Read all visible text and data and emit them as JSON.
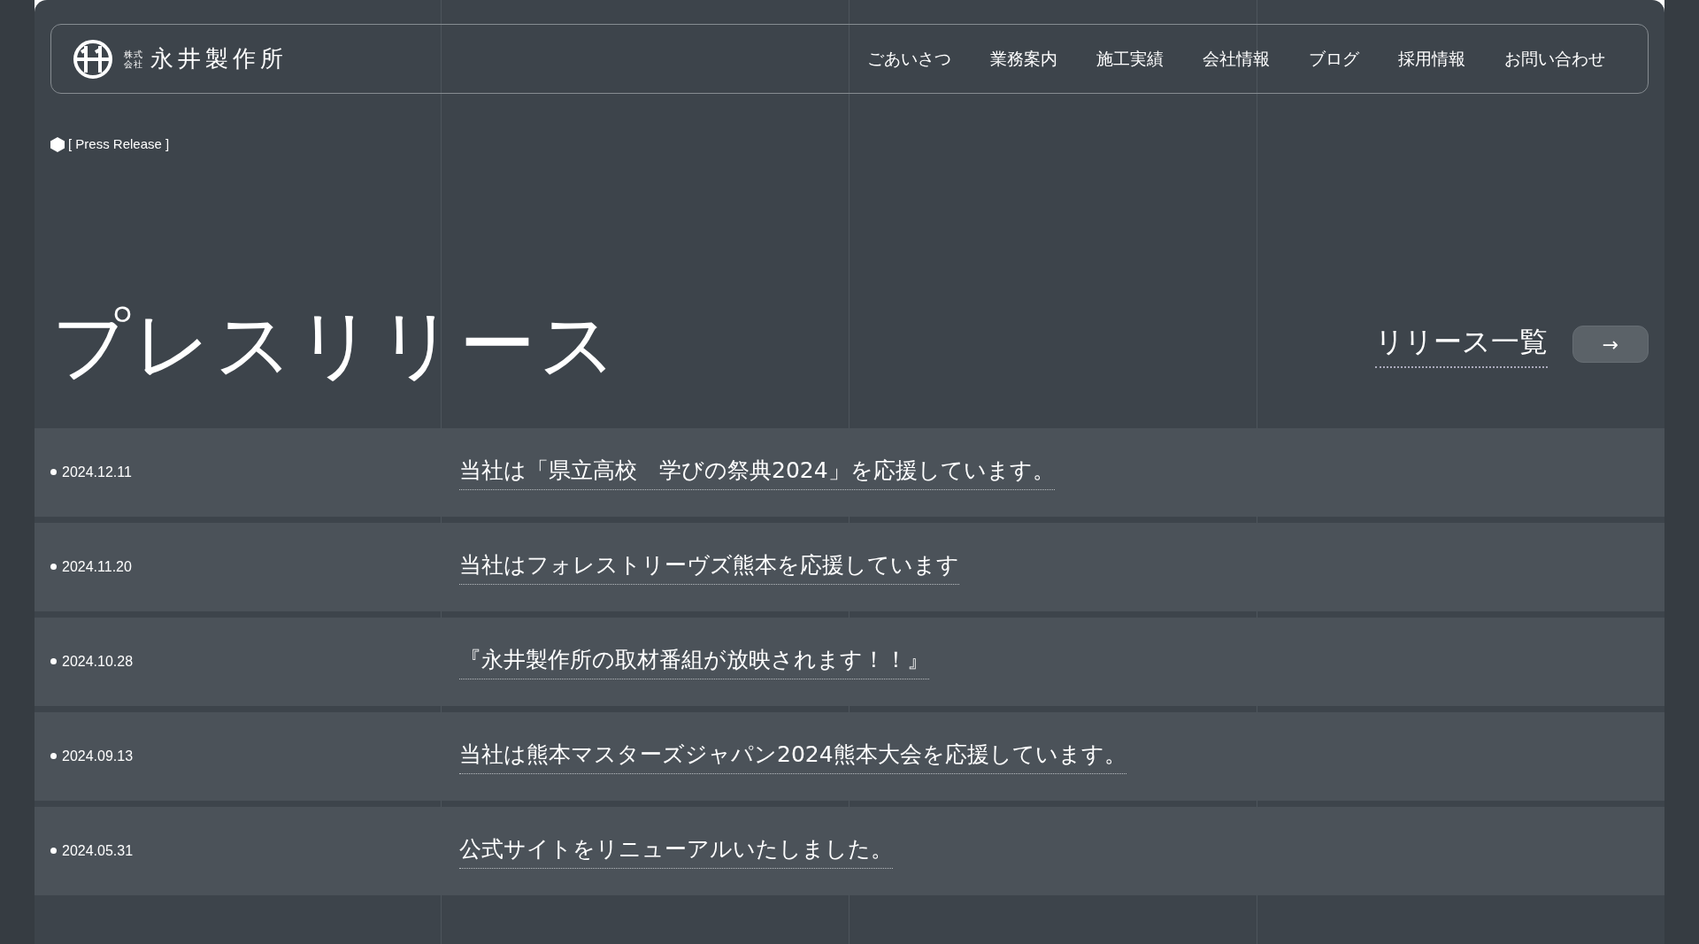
{
  "header": {
    "logo": {
      "prefix": [
        "株式",
        "会社"
      ],
      "name": "永井製作所"
    },
    "nav": [
      "ごあいさつ",
      "業務案内",
      "施工実績",
      "会社情報",
      "ブログ",
      "採用情報",
      "お問い合わせ"
    ]
  },
  "section_label": "[ Press Release ]",
  "title": "プレスリリース",
  "list_link": "リリース一覧",
  "arrow_button": "→",
  "releases": [
    {
      "date": "2024.12.11",
      "title": "当社は「県立高校　学びの祭典2024」を応援しています。"
    },
    {
      "date": "2024.11.20",
      "title": "当社はフォレストリーヴズ熊本を応援しています"
    },
    {
      "date": "2024.10.28",
      "title": "『永井製作所の取材番組が放映されます！！』"
    },
    {
      "date": "2024.09.13",
      "title": "当社は熊本マスターズジャパン2024熊本大会を応援しています。"
    },
    {
      "date": "2024.05.31",
      "title": "公式サイトをリニューアルいたしました。"
    }
  ]
}
